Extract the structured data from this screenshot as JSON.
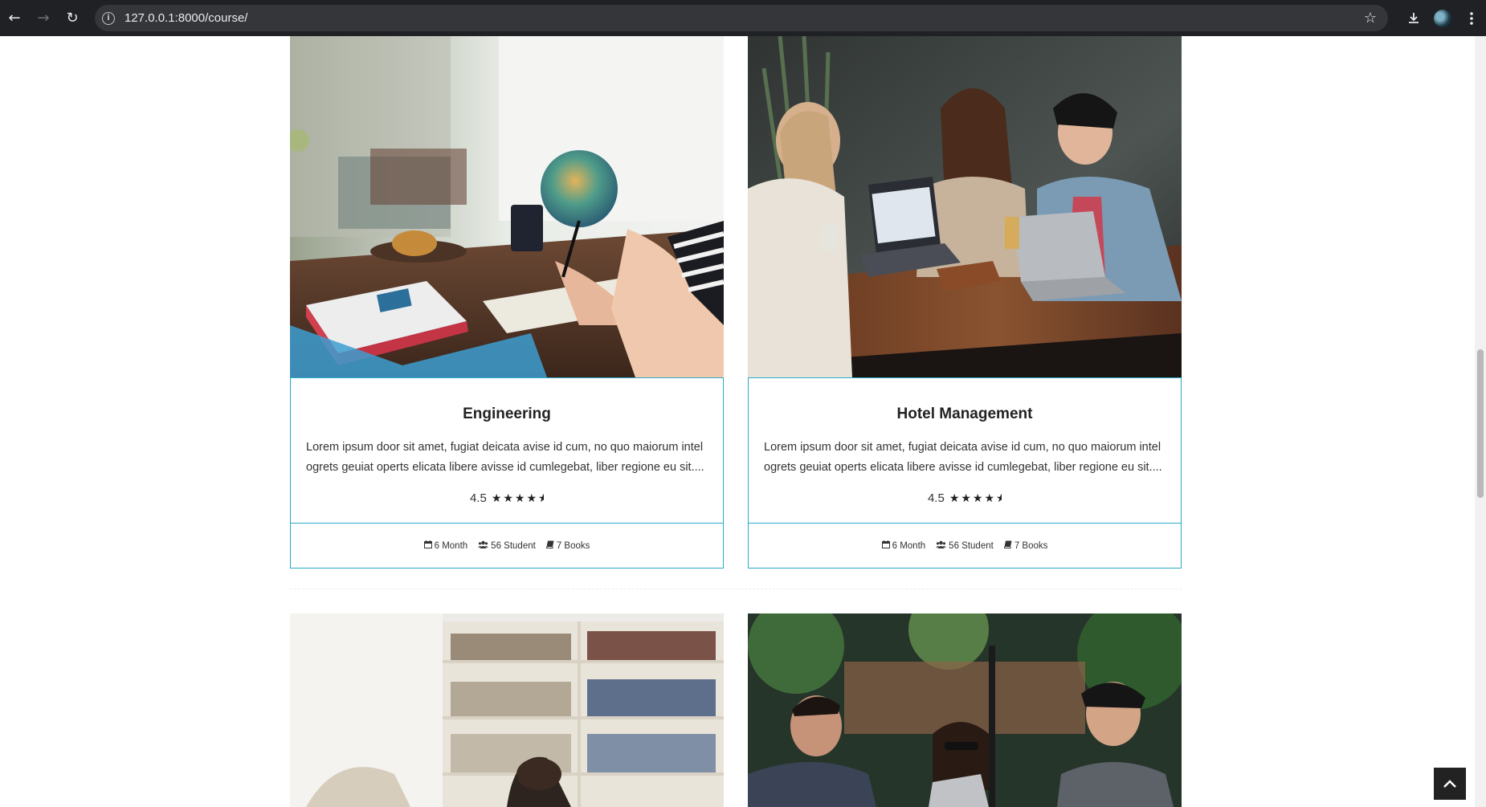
{
  "browser": {
    "url": "127.0.0.1:8000/course/"
  },
  "courses": [
    {
      "title": "Engineering",
      "description": "Lorem ipsum door sit amet, fugiat deicata avise id cum, no quo maiorum intel ogrets geuiat operts elicata libere avisse id cumlegebat, liber regione eu sit....",
      "rating": "4.5",
      "rating_value": 4.5,
      "duration": "6 Month",
      "students": "56 Student",
      "books": "7 Books"
    },
    {
      "title": "Hotel Management",
      "description": "Lorem ipsum door sit amet, fugiat deicata avise id cum, no quo maiorum intel ogrets geuiat operts elicata libere avisse id cumlegebat, liber regione eu sit....",
      "rating": "4.5",
      "rating_value": 4.5,
      "duration": "6 Month",
      "students": "56 Student",
      "books": "7 Books"
    }
  ],
  "icons": {
    "calendar": "calendar-icon",
    "students": "users-icon",
    "books": "book-icon",
    "back_to_top": "chevron-up-icon"
  }
}
